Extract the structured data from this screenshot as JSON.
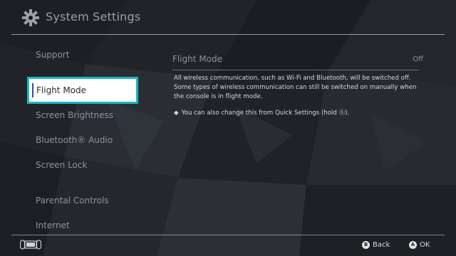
{
  "header": {
    "title": "System Settings",
    "icon": "gear-icon"
  },
  "sidebar": {
    "items": [
      {
        "label": "Support"
      },
      {
        "label": "Flight Mode",
        "selected": true
      },
      {
        "label": "Screen Brightness"
      },
      {
        "label": "Bluetooth® Audio"
      },
      {
        "label": "Screen Lock"
      },
      {
        "label": "Parental Controls"
      },
      {
        "label": "Internet"
      }
    ]
  },
  "content": {
    "option_title": "Flight Mode",
    "option_value": "Off",
    "description": "All wireless communication, such as Wi-Fi and Bluetooth, will be switched off. Some types of wireless communication can still be switched on manually when the console is in flight mode.",
    "hint_bullet": "◆",
    "hint": "You can also change this from Quick Settings (hold ⓗ)."
  },
  "footer": {
    "back_button": "B",
    "back_label": "Back",
    "ok_button": "A",
    "ok_label": "OK"
  },
  "colors": {
    "accent": "#17b8c9",
    "background": "#17191c"
  }
}
